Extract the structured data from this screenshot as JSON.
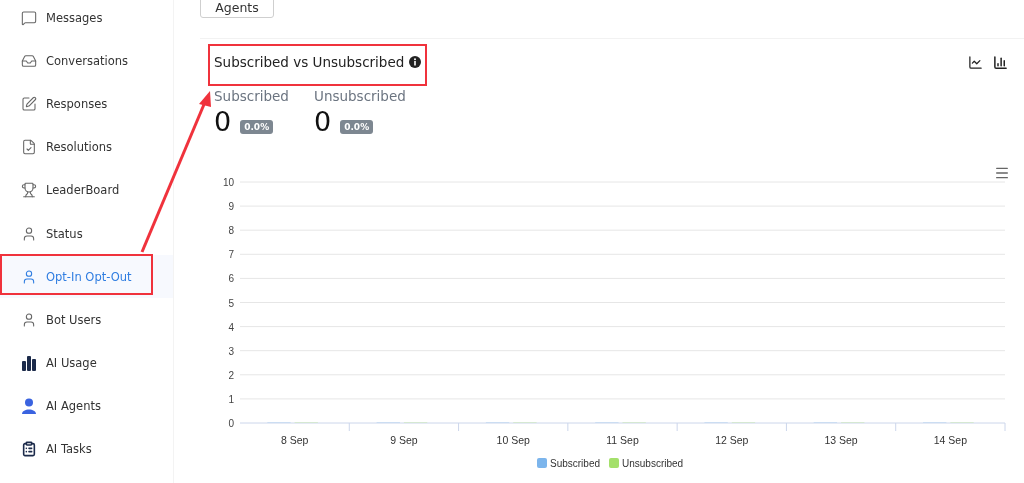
{
  "sidebar": {
    "items": [
      {
        "label": "Messages",
        "selected": false
      },
      {
        "label": "Conversations",
        "selected": false
      },
      {
        "label": "Responses",
        "selected": false
      },
      {
        "label": "Resolutions",
        "selected": false
      },
      {
        "label": "LeaderBoard",
        "selected": false
      },
      {
        "label": "Status",
        "selected": false
      },
      {
        "label": "Opt-In Opt-Out",
        "selected": true
      },
      {
        "label": "Bot Users",
        "selected": false
      },
      {
        "label": "AI Usage",
        "selected": false
      },
      {
        "label": "AI Agents",
        "selected": false
      },
      {
        "label": "AI Tasks",
        "selected": false
      }
    ]
  },
  "top_button": "Agents",
  "panel": {
    "title": "Subscribed vs Unsubscribed",
    "stats": [
      {
        "label": "Subscribed",
        "value": "0",
        "percent": "0.0%"
      },
      {
        "label": "Unsubscribed",
        "value": "0",
        "percent": "0.0%"
      }
    ],
    "chart_data": {
      "type": "bar",
      "categories": [
        "8 Sep",
        "9 Sep",
        "10 Sep",
        "11 Sep",
        "12 Sep",
        "13 Sep",
        "14 Sep"
      ],
      "series": [
        {
          "name": "Subscribed",
          "color": "#7cb5ec",
          "values": [
            0,
            0,
            0,
            0,
            0,
            0,
            0
          ]
        },
        {
          "name": "Unsubscribed",
          "color": "#a4e06b",
          "values": [
            0,
            0,
            0,
            0,
            0,
            0,
            0
          ]
        }
      ],
      "grid": true,
      "legend": true,
      "ylim": [
        0,
        10
      ],
      "yticks": [
        0,
        1,
        2,
        3,
        4,
        5,
        6,
        7,
        8,
        9,
        10
      ]
    }
  }
}
